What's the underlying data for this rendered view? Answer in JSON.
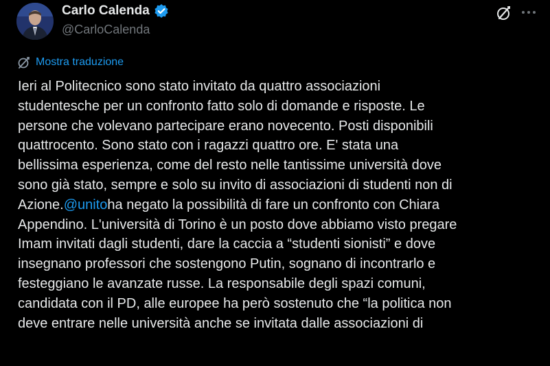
{
  "author": {
    "display_name": "Carlo Calenda",
    "handle": "@CarloCalenda"
  },
  "translate": {
    "label": "Mostra traduzione"
  },
  "icons": {
    "verified": "verified-badge-icon",
    "grok": "grok-icon",
    "more": "more-options-icon",
    "translate": "translate-icon"
  },
  "colors": {
    "background": "#000000",
    "text": "#e7e9ea",
    "secondary": "#71767b",
    "accent": "#1d9bf0"
  },
  "tweet": {
    "line_1": "Ieri al Politecnico sono stato invitato da quattro associazioni",
    "line_2": "studentesche per un confronto fatto solo di domande e risposte. Le",
    "line_3": "persone che volevano partecipare erano novecento. Posti disponibili",
    "line_4": "quattrocento. Sono stato con i ragazzi quattro ore. E' stata una",
    "line_5": "bellissima esperienza, come del resto nelle tantissime università dove",
    "line_6": "sono già stato, sempre e solo su invito di associazioni di studenti non di",
    "line_7_before": "Azione.",
    "mention": "@unito",
    "line_7_after": "ha negato la possibilità di fare un confronto con Chiara",
    "line_8": "Appendino. L'università di Torino è un posto dove abbiamo visto pregare",
    "line_9": "Imam invitati dagli studenti, dare la caccia a “studenti sionisti” e dove",
    "line_10": "insegnano professori che sostengono Putin, sognano di incontrarlo e",
    "line_11": "festeggiano le avanzate russe. La responsabile degli spazi comuni,",
    "line_12": "candidata con il PD, alle europee ha però sostenuto che “la politica non",
    "line_13": "deve entrare nelle università anche se invitata dalle associazioni di"
  }
}
